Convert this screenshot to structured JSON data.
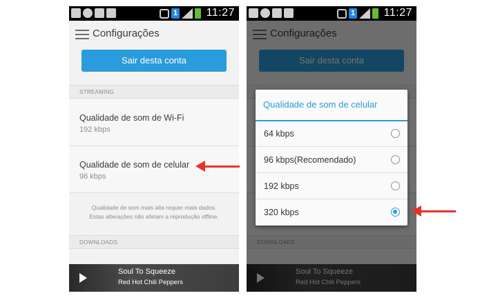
{
  "status_bar": {
    "time": "11:27",
    "badge": "1"
  },
  "app_bar": {
    "title": "Configurações"
  },
  "account": {
    "logout_label": "Sair desta conta"
  },
  "sections": {
    "streaming": "STREAMING",
    "downloads": "DOWNLOADS"
  },
  "wifi_quality": {
    "title": "Qualidade de som de Wi-Fi",
    "value": "192 kbps"
  },
  "cell_quality": {
    "title": "Qualidade de som de celular",
    "value": "96 kbps"
  },
  "note": {
    "line1": "Qualidade de som mais alta requer mais dados.",
    "line2": "Estas alterações não afetam a reprodução offline."
  },
  "player": {
    "track": "Soul To Squeeze",
    "artist": "Red Hot Chili Peppers"
  },
  "dialog": {
    "title": "Qualidade de som de celular",
    "options": [
      {
        "label": "64 kbps",
        "selected": false
      },
      {
        "label": "96 kbps(Recomendado)",
        "selected": false
      },
      {
        "label": "192 kbps",
        "selected": false
      },
      {
        "label": "320 kbps",
        "selected": true
      }
    ]
  },
  "colors": {
    "accent": "#2a9bdc",
    "arrow": "#e8322b"
  },
  "icons": [
    "hamburger-menu-icon",
    "play-icon",
    "radio-icon",
    "arrow-icon"
  ]
}
